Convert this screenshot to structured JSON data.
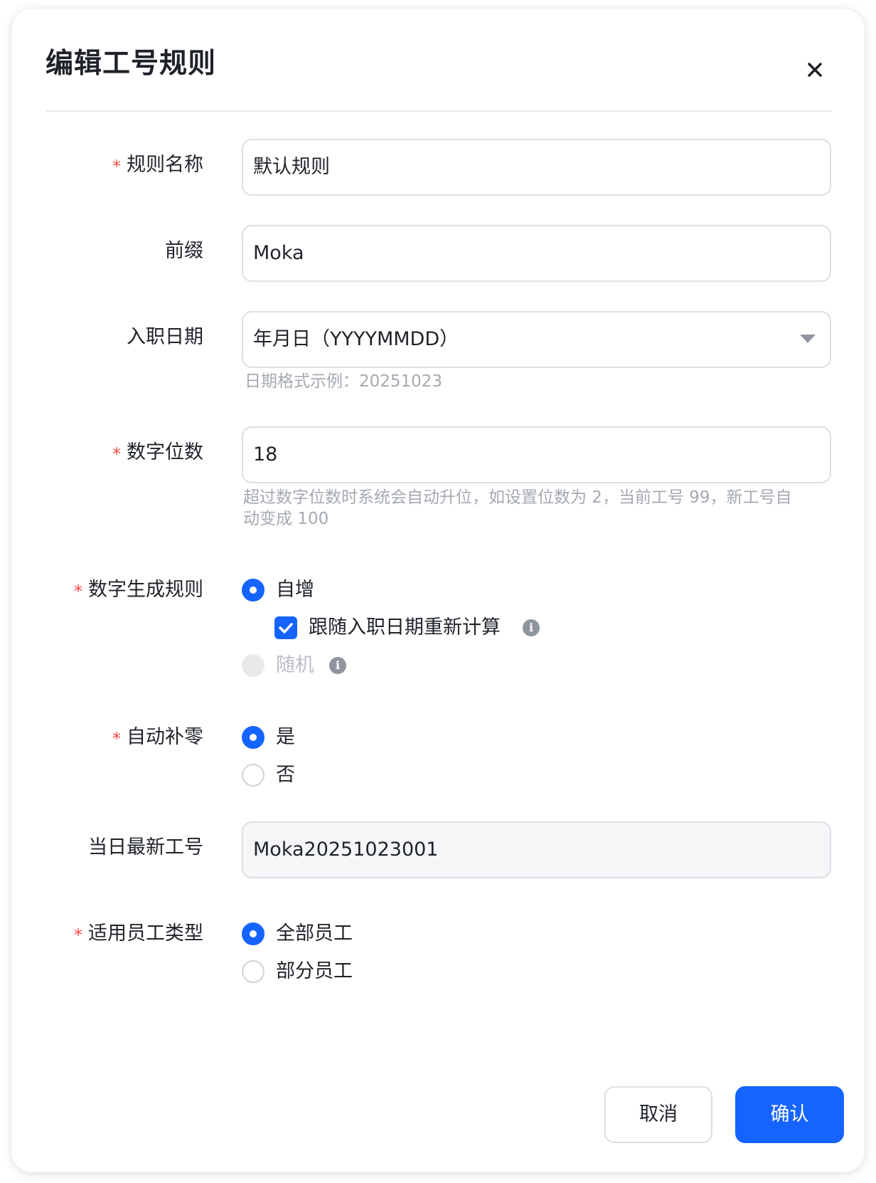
{
  "dialog": {
    "title": "编辑工号规则",
    "close_icon": "close-icon"
  },
  "fields": {
    "rule_name": {
      "label": "规则名称",
      "required": true,
      "value": "默认规则"
    },
    "prefix": {
      "label": "前缀",
      "required": false,
      "value": "Moka"
    },
    "hire_date": {
      "label": "入职日期",
      "required": false,
      "value": "年月日（YYYYMMDD）",
      "hint": "日期格式示例：20251023"
    },
    "digit_count": {
      "label": "数字位数",
      "required": true,
      "value": "18",
      "hint_line1": "超过数字位数时系统会自动升位，如设置位数为 2，当前工号 99，新工号自",
      "hint_line2": "动变成 100"
    },
    "number_rule": {
      "label": "数字生成规则",
      "required": true,
      "options": [
        {
          "label": "自增",
          "checked": true,
          "disabled": false
        },
        {
          "label": "随机",
          "checked": false,
          "disabled": true
        }
      ],
      "sub_checkbox": {
        "label": "跟随入职日期重新计算",
        "checked": true
      }
    },
    "zero_pad": {
      "label": "自动补零",
      "required": true,
      "options": [
        {
          "label": "是",
          "checked": true
        },
        {
          "label": "否",
          "checked": false
        }
      ]
    },
    "latest_id": {
      "label": "当日最新工号",
      "required": false,
      "value": "Moka20251023001"
    },
    "employee_type": {
      "label": "适用员工类型",
      "required": true,
      "options": [
        {
          "label": "全部员工",
          "checked": true
        },
        {
          "label": "部分员工",
          "checked": false
        }
      ]
    }
  },
  "required_mark": "*",
  "buttons": {
    "cancel": "取消",
    "confirm": "确认"
  },
  "colors": {
    "primary": "#1664ff",
    "required": "#f54a45",
    "hint": "#a4a9b1"
  }
}
